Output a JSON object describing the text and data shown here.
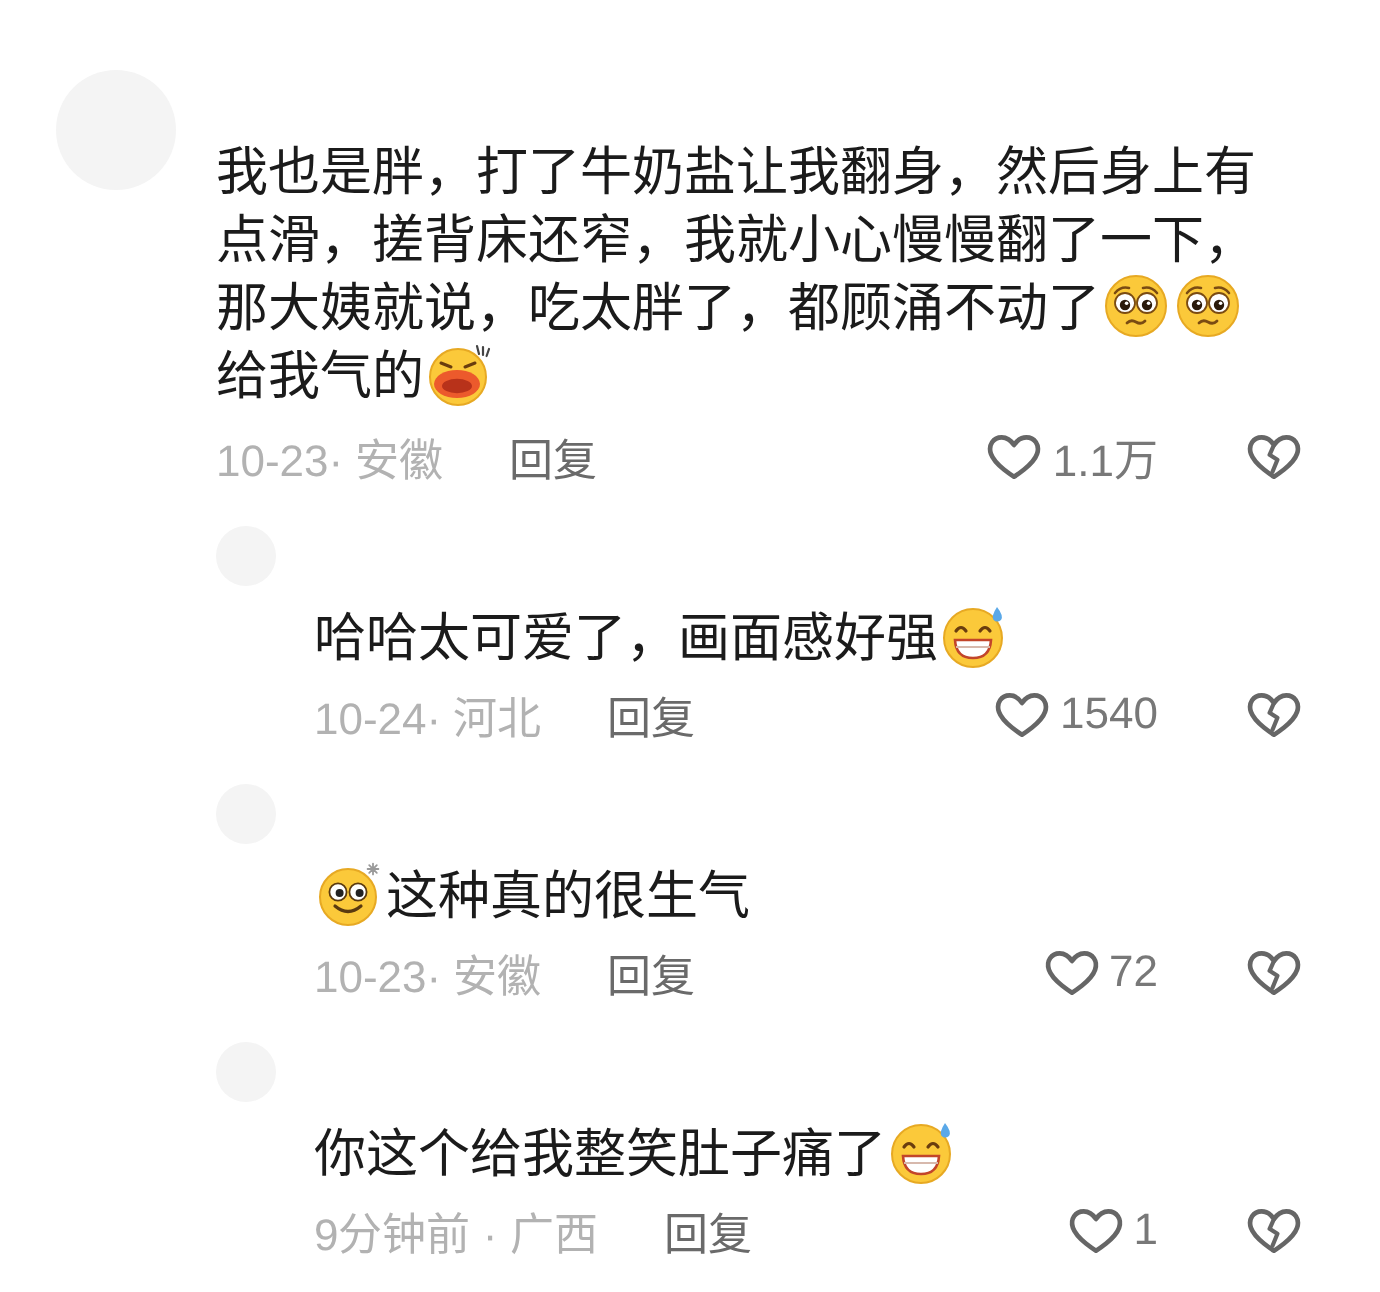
{
  "comment": {
    "content": [
      {
        "kind": "text",
        "text": "我也是胖，打了牛奶盐让我翻身，然后身上有点滑，搓背床还窄，我就小心慢慢翻了一下，"
      },
      {
        "kind": "text",
        "text": "那大姨就说，吃太胖了，都顾涌不动了"
      },
      {
        "kind": "plead"
      },
      {
        "kind": "plead"
      },
      {
        "kind": "text",
        "text": "给我气的"
      },
      {
        "kind": "fume"
      }
    ],
    "meta": "10-23· 安徽",
    "reply_label": "回复",
    "likes": "1.1万",
    "replies": [
      {
        "content": [
          {
            "kind": "text",
            "text": "哈哈太可爱了，画面感好强"
          },
          {
            "kind": "sweat"
          }
        ],
        "meta": "10-24· 河北",
        "reply_label": "回复",
        "likes": "1540"
      },
      {
        "content": [
          {
            "kind": "dizzy"
          },
          {
            "kind": "text",
            "text": "这种真的很生气"
          }
        ],
        "meta": "10-23· 安徽",
        "reply_label": "回复",
        "likes": "72"
      },
      {
        "content": [
          {
            "kind": "text",
            "text": "你这个给我整笑肚子痛了"
          },
          {
            "kind": "sweat"
          }
        ],
        "meta": "9分钟前 · 广西",
        "reply_label": "回复",
        "likes": "1"
      }
    ]
  }
}
